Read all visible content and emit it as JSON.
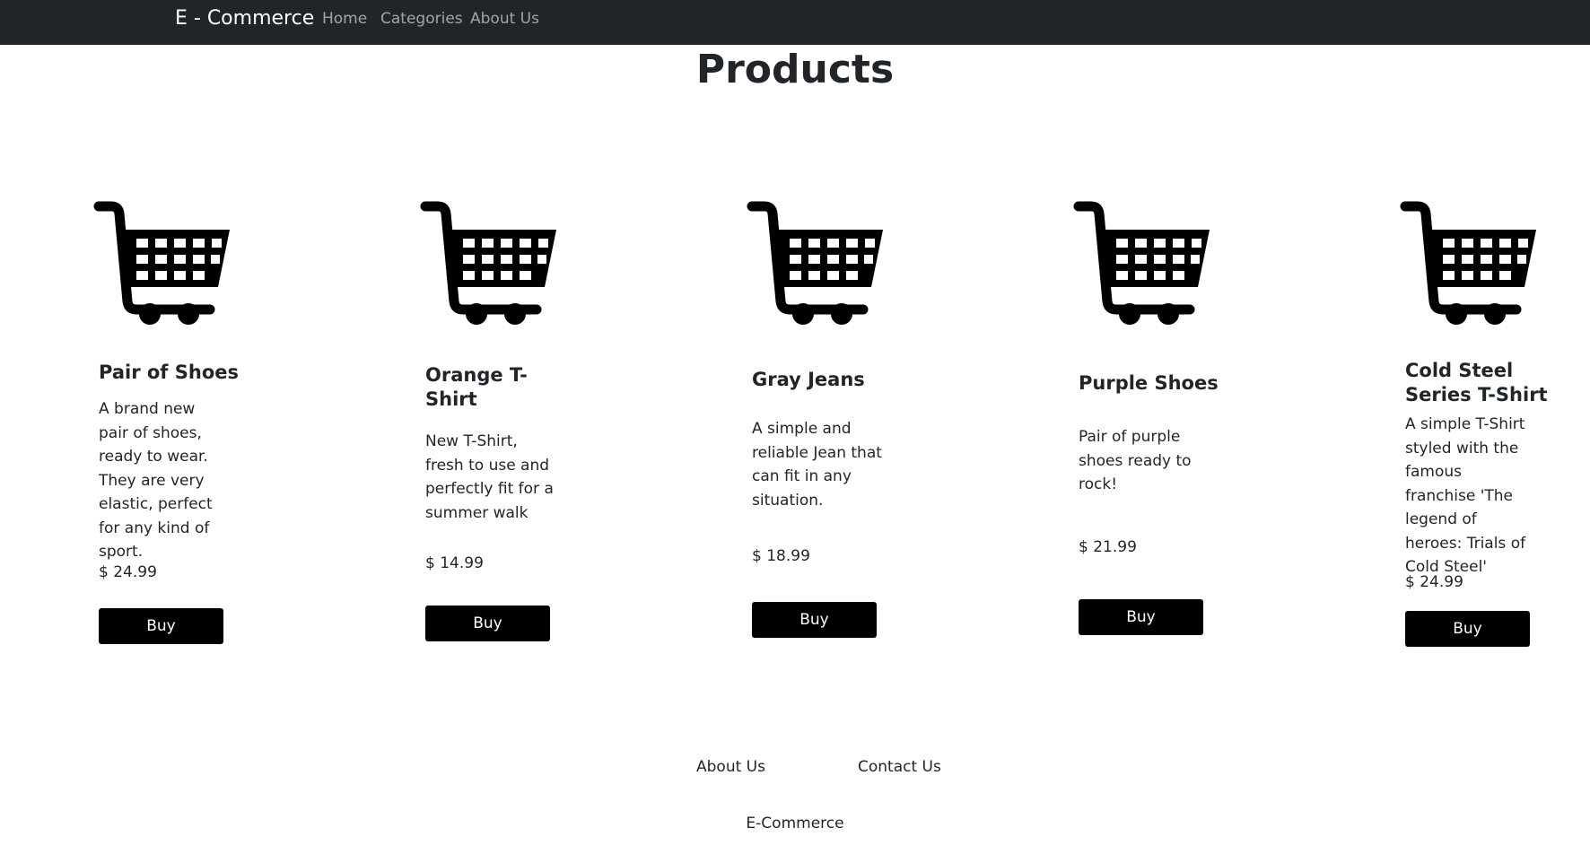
{
  "navbar": {
    "brand": "E - Commerce",
    "links": [
      "Home",
      "Categories",
      "About Us"
    ]
  },
  "page_title": "Products",
  "products": [
    {
      "title": "Pair of Shoes",
      "description": "A brand new pair of shoes, ready to wear. They are very elastic, perfect for any kind of sport.",
      "price": "$ 24.99",
      "button": "Buy",
      "icon": "shopping-cart-icon"
    },
    {
      "title": "Orange T-Shirt",
      "description": "New T-Shirt, fresh to use and perfectly fit for a summer walk",
      "price": "$ 14.99",
      "button": "Buy",
      "icon": "shopping-cart-icon"
    },
    {
      "title": "Gray Jeans",
      "description": "A simple and reliable Jean that can fit in any situation.",
      "price": "$ 18.99",
      "button": "Buy",
      "icon": "shopping-cart-icon"
    },
    {
      "title": "Purple Shoes",
      "description": "Pair of purple shoes ready to rock!",
      "price": "$ 21.99",
      "button": "Buy",
      "icon": "shopping-cart-icon"
    },
    {
      "title": "Cold Steel Series T-Shirt",
      "description": "A simple T-Shirt styled with the famous franchise 'The legend of heroes: Trials of Cold Steel'",
      "price": "$ 24.99",
      "button": "Buy",
      "icon": "shopping-cart-icon"
    }
  ],
  "footer": {
    "links": [
      "About Us",
      "Contact Us"
    ],
    "copyright": "E-Commerce"
  },
  "colors": {
    "navbar_bg": "#212529",
    "button_bg": "#000000",
    "text": "#212529"
  }
}
